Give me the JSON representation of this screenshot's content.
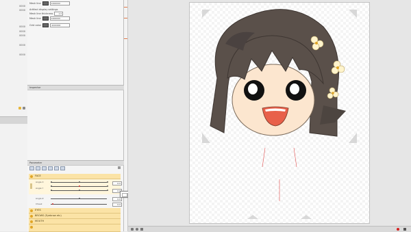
{
  "left_strip": {
    "ticks": [
      "0000",
      "0000",
      "0000",
      "0000",
      "0000",
      "0000",
      "0000"
    ]
  },
  "object_props": {
    "mesh_line_color_label": "Mesh line",
    "mesh_line_color_value": "4000000",
    "display_settings_label": "Artifact display settings",
    "mesh_line_thickness_label": "Mesh line thickness",
    "mesh_line_thickness_value": "1.0",
    "mesh_line_color2_label": "Mesh line",
    "mesh_line_color2_value": "4000000",
    "grid_color_label": "Grid color",
    "grid_color_value": "4000000"
  },
  "inspector": {
    "header": "Inspector"
  },
  "parameters": {
    "header": "Parameter",
    "groups": [
      {
        "label": "FACE"
      },
      {
        "label": "EYES"
      },
      {
        "label": "BROWS (Eyebrow etc)"
      },
      {
        "label": "MOUTH"
      }
    ],
    "rows": [
      {
        "label": "Angle X",
        "value": "0.0"
      },
      {
        "label": "Angle Y",
        "value": "0.0"
      },
      {
        "label": "Angle Z",
        "value": "0.0"
      },
      {
        "label": "Cheek",
        "value": "0.0"
      }
    ]
  },
  "popup": {
    "value": "0"
  },
  "colors": {
    "accent": "#fbe3a6",
    "hair": "#5a504a",
    "skin": "#fce6cf",
    "mouth": "#e8604a"
  },
  "icons": [
    "gear-icon",
    "folder-icon",
    "search-icon",
    "lock-icon"
  ]
}
